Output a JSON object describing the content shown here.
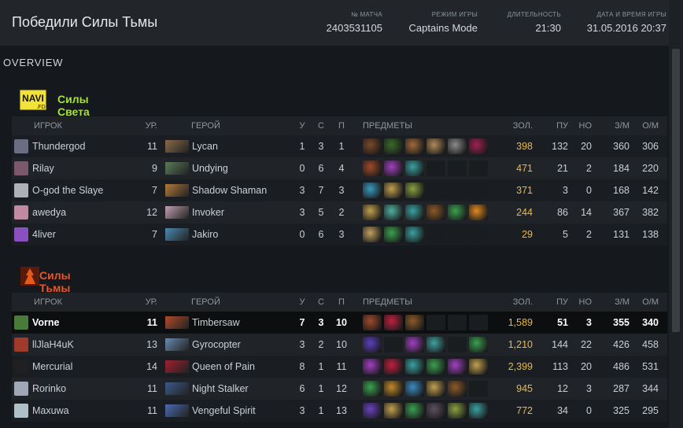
{
  "header": {
    "winner": "Победили Силы Тьмы",
    "match_label": "№ МАТЧА",
    "match_id": "2403531105",
    "mode_label": "РЕЖИМ ИГРЫ",
    "mode": "Captains Mode",
    "duration_label": "ДЛИТЕЛЬНОСТЬ",
    "duration": "21:30",
    "date_label": "ДАТА И ВРЕМЯ ИГРЫ",
    "date": "31.05.2016 20:37"
  },
  "section_title": "OVERVIEW",
  "columns": {
    "player": "ИГРОК",
    "level": "УР.",
    "hero": "ГЕРОЙ",
    "kills": "У",
    "deaths": "С",
    "assists": "П",
    "items": "ПРЕДМЕТЫ",
    "gold": "ЗОЛ.",
    "last_hits": "ПУ",
    "denies": "НО",
    "gpm": "З/М",
    "xpm": "О/М"
  },
  "radiant": {
    "name": "Силы Света",
    "color": "#a8e03a",
    "logo": "navi-logo",
    "players": [
      {
        "name": "Thundergod",
        "level": "11",
        "hero": "Lycan",
        "k": "1",
        "d": "3",
        "a": "1",
        "gold": "398",
        "lh": "132",
        "dn": "20",
        "gpm": "360",
        "xpm": "306",
        "avatar": "#6a6e84",
        "hero_color": "#8a6a4a",
        "items": [
          "#7a4a2a",
          "#3a6a2a",
          "#a06a3a",
          "#b08a5a",
          "#8a8a8a",
          "#a02050"
        ]
      },
      {
        "name": "Rilay",
        "level": "9",
        "hero": "Undying",
        "k": "0",
        "d": "6",
        "a": "4",
        "gold": "471",
        "lh": "21",
        "dn": "2",
        "gpm": "184",
        "xpm": "220",
        "avatar": "#7a5a6a",
        "hero_color": "#5a7a5a",
        "items": [
          "#a04a2a",
          "#a040c0",
          "#3aa0a0",
          "",
          "",
          ""
        ]
      },
      {
        "name": "O-god the Slaye",
        "level": "7",
        "hero": "Shadow Shaman",
        "k": "3",
        "d": "7",
        "a": "3",
        "gold": "371",
        "lh": "3",
        "dn": "0",
        "gpm": "168",
        "xpm": "142",
        "avatar": "#b0b0b8",
        "hero_color": "#b07a3a",
        "items": [
          "#3a9ac0",
          "#c0a050",
          "#8aa040",
          "",
          "",
          ""
        ]
      },
      {
        "name": "awedya",
        "level": "12",
        "hero": "Invoker",
        "k": "3",
        "d": "5",
        "a": "2",
        "gold": "244",
        "lh": "86",
        "dn": "14",
        "gpm": "367",
        "xpm": "382",
        "avatar": "#c08aa0",
        "hero_color": "#c0a0b0",
        "items": [
          "#c0a050",
          "#50b0a0",
          "#3aa0a0",
          "#8a5a2a",
          "#3aa050",
          "#e08a20"
        ]
      },
      {
        "name": "4liver",
        "level": "7",
        "hero": "Jakiro",
        "k": "0",
        "d": "6",
        "a": "3",
        "gold": "29",
        "lh": "5",
        "dn": "2",
        "gpm": "131",
        "xpm": "138",
        "avatar": "#8a50c0",
        "hero_color": "#4a8ab0",
        "items": [
          "#c0a060",
          "#3aa050",
          "#3aa0a0",
          "",
          "",
          ""
        ]
      }
    ]
  },
  "dire": {
    "name": "Силы Тьмы",
    "color": "#e8552a",
    "logo": "dire-logo",
    "players": [
      {
        "name": "Vorne",
        "level": "11",
        "hero": "Timbersaw",
        "k": "7",
        "d": "3",
        "a": "10",
        "gold": "1,589",
        "lh": "51",
        "dn": "3",
        "gpm": "355",
        "xpm": "340",
        "avatar": "#4a7a3a",
        "hero_color": "#b04a2a",
        "items": [
          "#a04a2a",
          "#c02040",
          "#8a5a2a",
          "",
          "",
          ""
        ]
      },
      {
        "name": "llJlaH4uK",
        "level": "13",
        "hero": "Gyrocopter",
        "k": "3",
        "d": "2",
        "a": "10",
        "gold": "1,210",
        "lh": "144",
        "dn": "22",
        "gpm": "426",
        "xpm": "458",
        "avatar": "#a03a2a",
        "hero_color": "#6a8ab0",
        "items": [
          "#5a40c0",
          "",
          "#a040c0",
          "#40a0a0",
          "",
          "#3aa050"
        ]
      },
      {
        "name": "Mercurial",
        "level": "14",
        "hero": "Queen of Pain",
        "k": "8",
        "d": "1",
        "a": "11",
        "gold": "2,399",
        "lh": "113",
        "dn": "20",
        "gpm": "486",
        "xpm": "531",
        "avatar": "#202020",
        "hero_color": "#a02030",
        "items": [
          "#a040c0",
          "#c02040",
          "#3aa0a0",
          "#3aa050",
          "#a040c0",
          "#c0a050"
        ]
      },
      {
        "name": "Rorinko",
        "level": "11",
        "hero": "Night Stalker",
        "k": "6",
        "d": "1",
        "a": "12",
        "gold": "945",
        "lh": "12",
        "dn": "3",
        "gpm": "287",
        "xpm": "344",
        "avatar": "#a0a8b8",
        "hero_color": "#3a5a8a",
        "items": [
          "#3aa050",
          "#c08a2a",
          "#3a8ac0",
          "#c0a050",
          "#8a5a2a",
          ""
        ]
      },
      {
        "name": "Maxuwa",
        "level": "11",
        "hero": "Vengeful Spirit",
        "k": "3",
        "d": "1",
        "a": "13",
        "gold": "772",
        "lh": "34",
        "dn": "0",
        "gpm": "325",
        "xpm": "295",
        "avatar": "#b0c0c8",
        "hero_color": "#4a6ab0",
        "items": [
          "#6a40c0",
          "#c0a050",
          "#3aa050",
          "#5a5060",
          "#8aa040",
          "#3aa0a0"
        ]
      }
    ]
  }
}
